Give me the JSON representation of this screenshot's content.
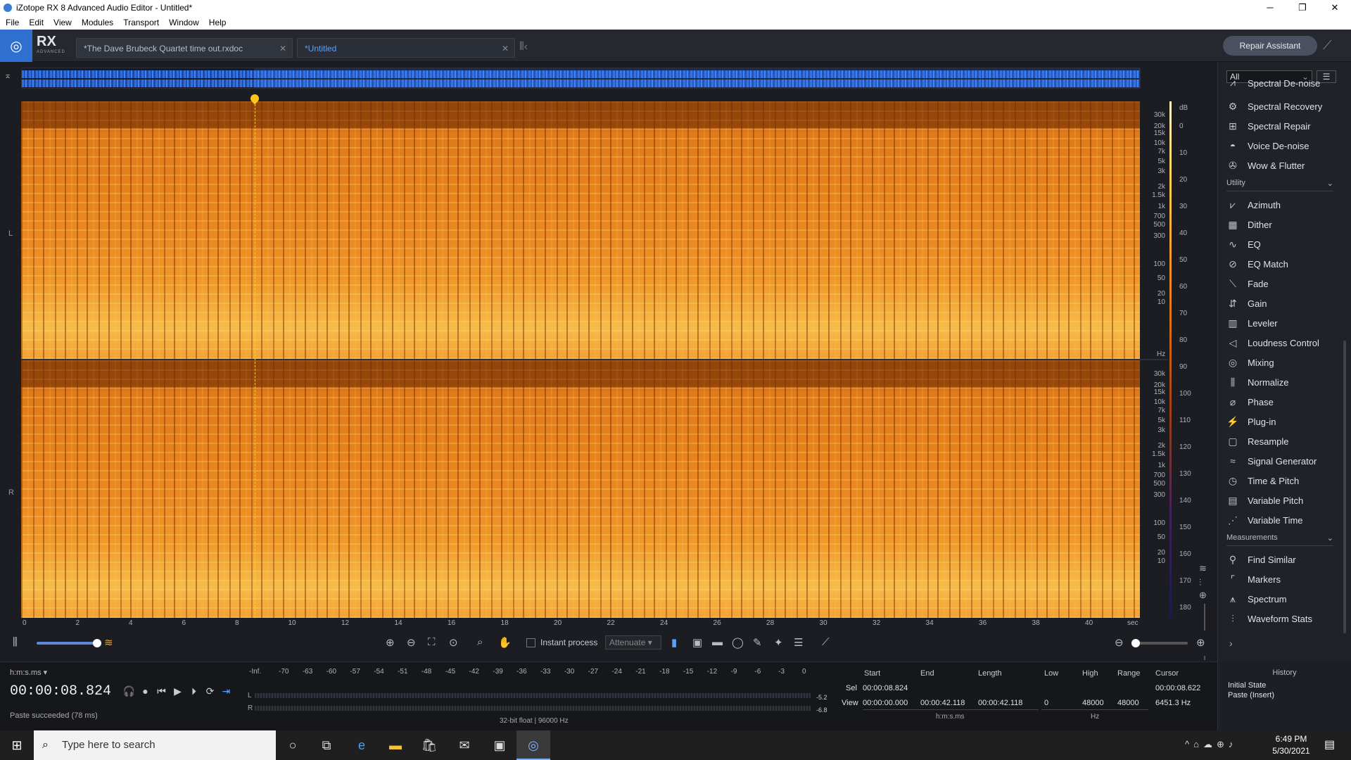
{
  "window": {
    "title": "iZotope RX 8 Advanced Audio Editor - Untitled*",
    "minimize": "─",
    "restore": "❐",
    "close": "✕"
  },
  "menu": [
    "File",
    "Edit",
    "View",
    "Modules",
    "Transport",
    "Window",
    "Help"
  ],
  "brand": {
    "name": "RX",
    "edition": "ADVANCED"
  },
  "tabs": [
    {
      "label": "*The Dave Brubeck Quartet  time out.rxdoc",
      "close": "✕"
    },
    {
      "label": "*Untitled",
      "close": "✕"
    }
  ],
  "repair_assistant": "Repair Assistant",
  "channels": {
    "left": "L",
    "right": "R"
  },
  "hz_labels": [
    "30k",
    "20k",
    "15k",
    "10k",
    "7k",
    "5k",
    "3k",
    "2k",
    "1.5k",
    "1k",
    "700",
    "500",
    "300",
    "100",
    "50",
    "20",
    "10"
  ],
  "hz_unit": "Hz",
  "db_unit": "dB",
  "db_labels": [
    "0",
    "10",
    "20",
    "30",
    "40",
    "50",
    "60",
    "70",
    "80",
    "90",
    "100",
    "110",
    "120",
    "130",
    "140",
    "150",
    "160",
    "170",
    "180"
  ],
  "time_labels": [
    "0",
    "2",
    "4",
    "6",
    "8",
    "10",
    "12",
    "14",
    "16",
    "18",
    "20",
    "22",
    "24",
    "26",
    "28",
    "30",
    "32",
    "34",
    "36",
    "38",
    "40"
  ],
  "time_unit": "sec",
  "tools": {
    "instant_process": "Instant process",
    "mode": "Attenuate"
  },
  "transport": {
    "format": "h:m:s.ms",
    "timecode": "00:00:08.824",
    "status": "Paste succeeded (78 ms)"
  },
  "meter": {
    "ticks": [
      "-Inf.",
      "-70",
      "-63",
      "-60",
      "-57",
      "-54",
      "-51",
      "-48",
      "-45",
      "-42",
      "-39",
      "-36",
      "-33",
      "-30",
      "-27",
      "-24",
      "-21",
      "-18",
      "-15",
      "-12",
      "-9",
      "-6",
      "-3",
      "0"
    ],
    "left_label": "L",
    "right_label": "R",
    "left_value": "-5.2",
    "right_value": "-6.8",
    "format": "32-bit float | 96000 Hz"
  },
  "selection": {
    "headers": {
      "start": "Start",
      "end": "End",
      "length": "Length",
      "low": "Low",
      "high": "High",
      "range": "Range",
      "cursor": "Cursor"
    },
    "sel_label": "Sel",
    "view_label": "View",
    "sel_start": "00:00:08.824",
    "view_start": "00:00:00.000",
    "view_end": "00:00:42.118",
    "view_length": "00:00:42.118",
    "low": "0",
    "high": "48000",
    "range": "48000",
    "cursor_time": "00:00:08.622",
    "cursor_freq": "6451.3 Hz",
    "time_unit": "h:m:s.ms",
    "freq_unit": "Hz"
  },
  "modules_panel": {
    "filter": "All",
    "partial_top": "Spectral De-noise",
    "repair": [
      "Spectral Recovery",
      "Spectral Repair",
      "Voice De-noise",
      "Wow & Flutter"
    ],
    "utility_header": "Utility",
    "utility": [
      "Azimuth",
      "Dither",
      "EQ",
      "EQ Match",
      "Fade",
      "Gain",
      "Leveler",
      "Loudness Control",
      "Mixing",
      "Normalize",
      "Phase",
      "Plug-in",
      "Resample",
      "Signal Generator",
      "Time & Pitch",
      "Variable Pitch",
      "Variable Time"
    ],
    "measurements_header": "Measurements",
    "measurements": [
      "Find Similar",
      "Markers",
      "Spectrum",
      "Waveform Stats"
    ]
  },
  "history": {
    "title": "History",
    "items": [
      "Initial State",
      "Paste (Insert)"
    ]
  },
  "taskbar": {
    "search_placeholder": "Type here to search",
    "time": "6:49 PM",
    "date": "5/30/2021"
  }
}
